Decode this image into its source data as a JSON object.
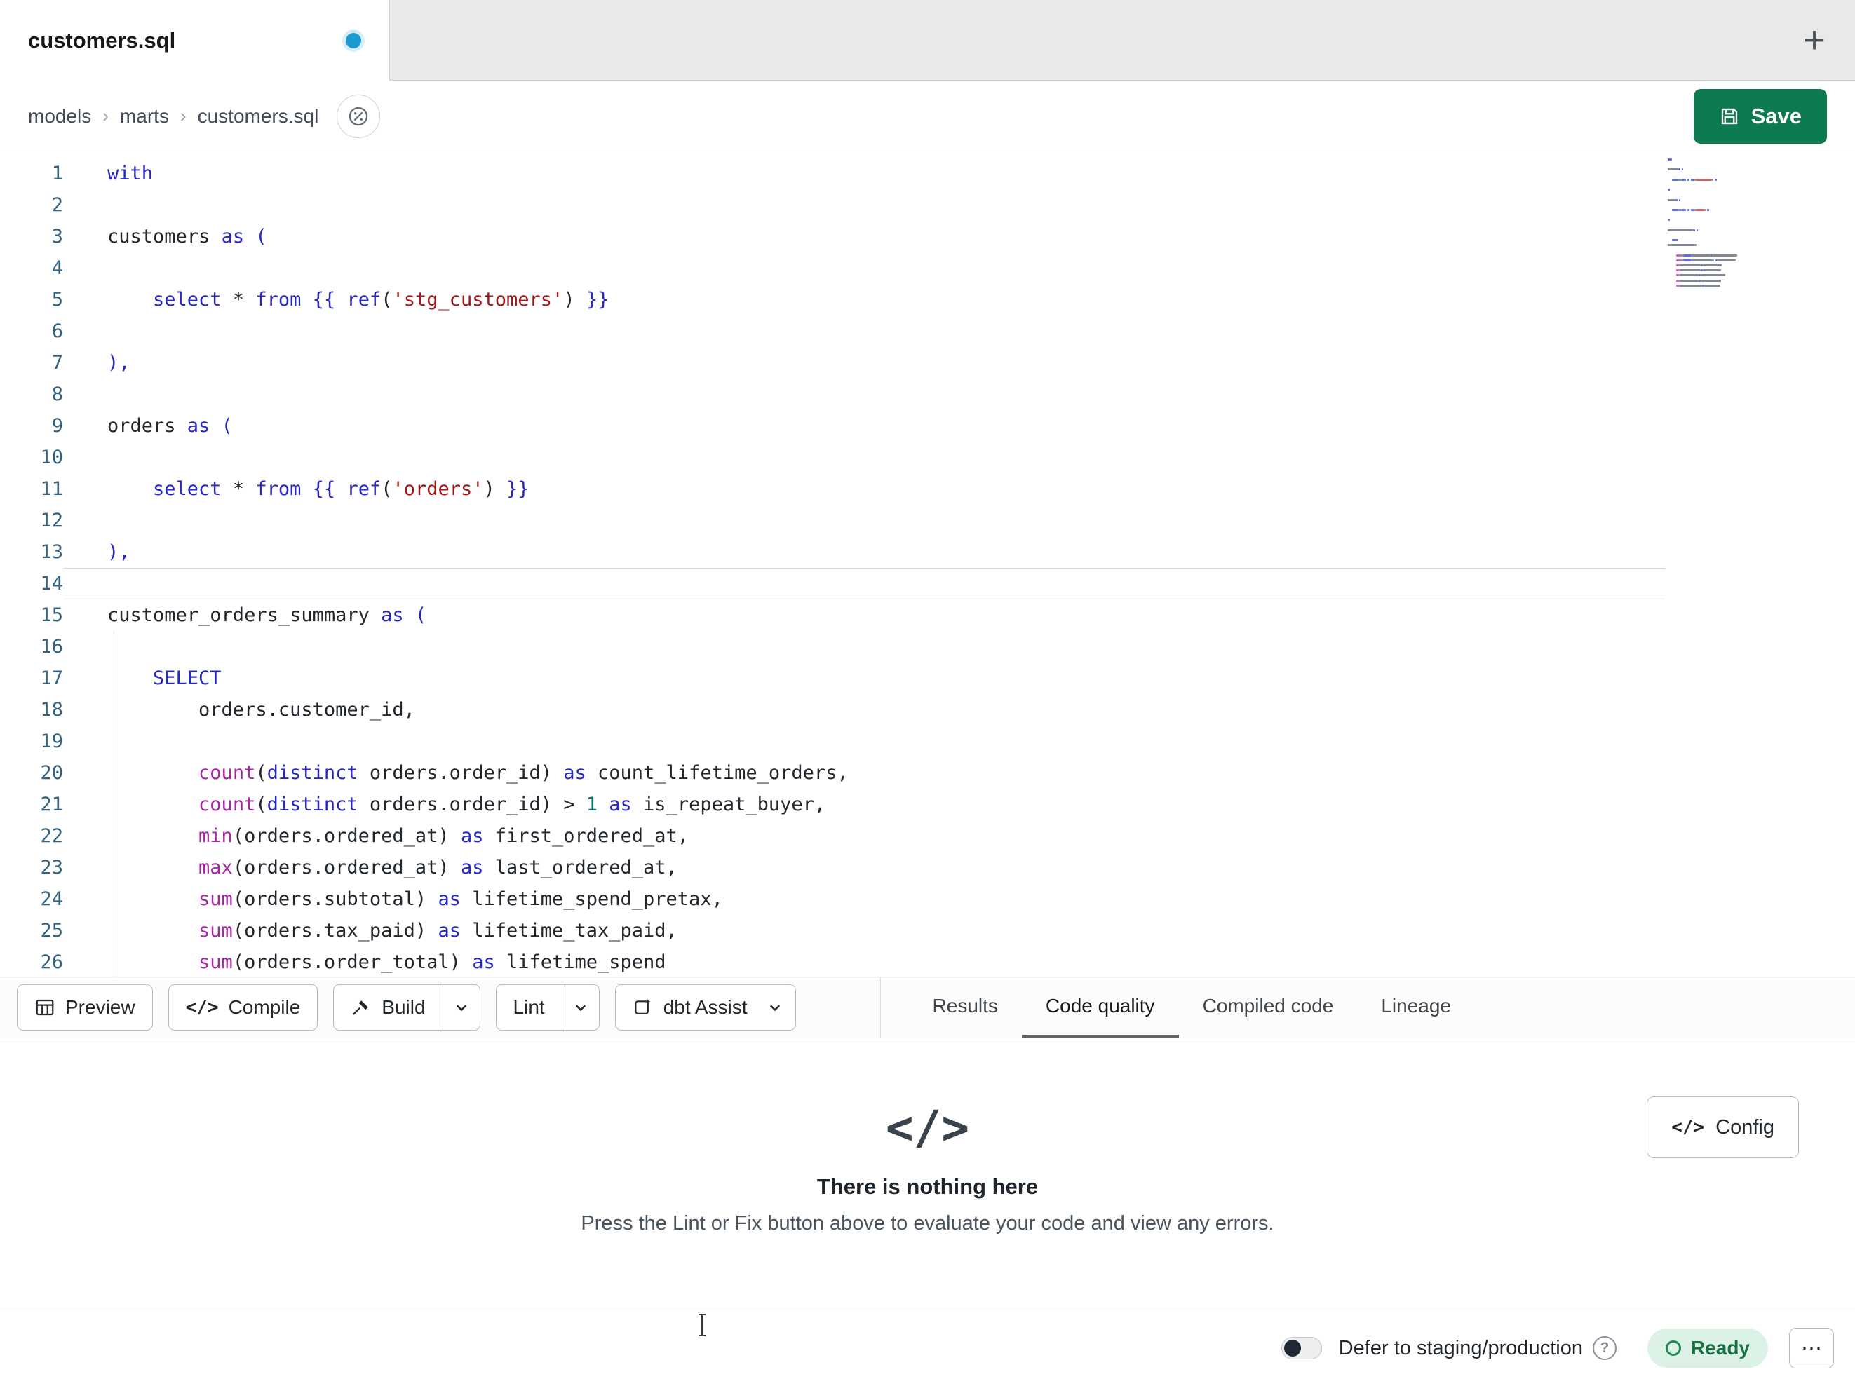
{
  "colors": {
    "save-green": "#0e7a4f",
    "dot-blue": "#1b9bd1",
    "ready-green": "#177142",
    "ready-bg": "#ddf2e6",
    "tab-underline": "#5f646a"
  },
  "tab_bar": {
    "tab_title": "customers.sql",
    "new_tab_label": "+"
  },
  "breadcrumb": {
    "items": [
      "models",
      "marts",
      "customers.sql"
    ],
    "separator": "›"
  },
  "header": {
    "save_label": "Save"
  },
  "editor": {
    "active_line": 14,
    "lines": [
      [
        [
          "k",
          "with"
        ]
      ],
      [],
      [
        [
          "p",
          "customers "
        ],
        [
          "k",
          "as"
        ],
        [
          "p",
          " "
        ],
        [
          "k",
          "("
        ]
      ],
      [],
      [
        [
          "p",
          "    "
        ],
        [
          "k",
          "select"
        ],
        [
          "p",
          " * "
        ],
        [
          "k",
          "from"
        ],
        [
          "p",
          " "
        ],
        [
          "k",
          "{{"
        ],
        [
          "p",
          " "
        ],
        [
          "k",
          "ref"
        ],
        [
          "p",
          "("
        ],
        [
          "s",
          "'stg_customers'"
        ],
        [
          "p",
          ")"
        ],
        [
          "p",
          " "
        ],
        [
          "k",
          "}}"
        ]
      ],
      [],
      [
        [
          "k",
          "),"
        ]
      ],
      [],
      [
        [
          "p",
          "orders "
        ],
        [
          "k",
          "as"
        ],
        [
          "p",
          " "
        ],
        [
          "k",
          "("
        ]
      ],
      [],
      [
        [
          "p",
          "    "
        ],
        [
          "k",
          "select"
        ],
        [
          "p",
          " * "
        ],
        [
          "k",
          "from"
        ],
        [
          "p",
          " "
        ],
        [
          "k",
          "{{"
        ],
        [
          "p",
          " "
        ],
        [
          "k",
          "ref"
        ],
        [
          "p",
          "("
        ],
        [
          "s",
          "'orders'"
        ],
        [
          "p",
          ")"
        ],
        [
          "p",
          " "
        ],
        [
          "k",
          "}}"
        ]
      ],
      [],
      [
        [
          "k",
          "),"
        ]
      ],
      [],
      [
        [
          "p",
          "customer_orders_summary "
        ],
        [
          "k",
          "as"
        ],
        [
          "p",
          " "
        ],
        [
          "k",
          "("
        ]
      ],
      [],
      [
        [
          "p",
          "    "
        ],
        [
          "k",
          "SELECT"
        ]
      ],
      [
        [
          "p",
          "        orders.customer_id,"
        ]
      ],
      [],
      [
        [
          "p",
          "        "
        ],
        [
          "f",
          "count"
        ],
        [
          "p",
          "("
        ],
        [
          "k",
          "distinct"
        ],
        [
          "p",
          " orders.order_id) "
        ],
        [
          "k",
          "as"
        ],
        [
          "p",
          " count_lifetime_orders,"
        ]
      ],
      [
        [
          "p",
          "        "
        ],
        [
          "f",
          "count"
        ],
        [
          "p",
          "("
        ],
        [
          "k",
          "distinct"
        ],
        [
          "p",
          " orders.order_id) > "
        ],
        [
          "n",
          "1"
        ],
        [
          "p",
          " "
        ],
        [
          "k",
          "as"
        ],
        [
          "p",
          " is_repeat_buyer,"
        ]
      ],
      [
        [
          "p",
          "        "
        ],
        [
          "f",
          "min"
        ],
        [
          "p",
          "(orders.ordered_at) "
        ],
        [
          "k",
          "as"
        ],
        [
          "p",
          " first_ordered_at,"
        ]
      ],
      [
        [
          "p",
          "        "
        ],
        [
          "f",
          "max"
        ],
        [
          "p",
          "(orders.ordered_at) "
        ],
        [
          "k",
          "as"
        ],
        [
          "p",
          " last_ordered_at,"
        ]
      ],
      [
        [
          "p",
          "        "
        ],
        [
          "f",
          "sum"
        ],
        [
          "p",
          "(orders.subtotal) "
        ],
        [
          "k",
          "as"
        ],
        [
          "p",
          " lifetime_spend_pretax,"
        ]
      ],
      [
        [
          "p",
          "        "
        ],
        [
          "f",
          "sum"
        ],
        [
          "p",
          "(orders.tax_paid) "
        ],
        [
          "k",
          "as"
        ],
        [
          "p",
          " lifetime_tax_paid,"
        ]
      ],
      [
        [
          "p",
          "        "
        ],
        [
          "f",
          "sum"
        ],
        [
          "p",
          "(orders.order_total) "
        ],
        [
          "k",
          "as"
        ],
        [
          "p",
          " lifetime_spend"
        ]
      ]
    ]
  },
  "toolbar": {
    "buttons": [
      {
        "label": "Preview",
        "icon": "table",
        "chevron": false,
        "split": false
      },
      {
        "label": "Compile",
        "icon": "code",
        "chevron": false,
        "split": false
      },
      {
        "label": "Build",
        "icon": "hammer",
        "chevron": true,
        "split": true
      },
      {
        "label": "Lint",
        "icon": null,
        "chevron": true,
        "split": true
      },
      {
        "label": "dbt Assist",
        "icon": "assist",
        "chevron": true,
        "split": false
      }
    ],
    "tabs": [
      {
        "label": "Results",
        "active": false
      },
      {
        "label": "Code quality",
        "active": true
      },
      {
        "label": "Compiled code",
        "active": false
      },
      {
        "label": "Lineage",
        "active": false
      }
    ]
  },
  "empty_state": {
    "title": "There is nothing here",
    "subtitle": "Press the Lint or Fix button above to evaluate your code and view any errors.",
    "icon_glyph": "</>",
    "config_label": "Config"
  },
  "status_bar": {
    "defer_label": "Defer to staging/production",
    "help_label": "?",
    "ready_label": "Ready",
    "more_label": "⋯"
  }
}
